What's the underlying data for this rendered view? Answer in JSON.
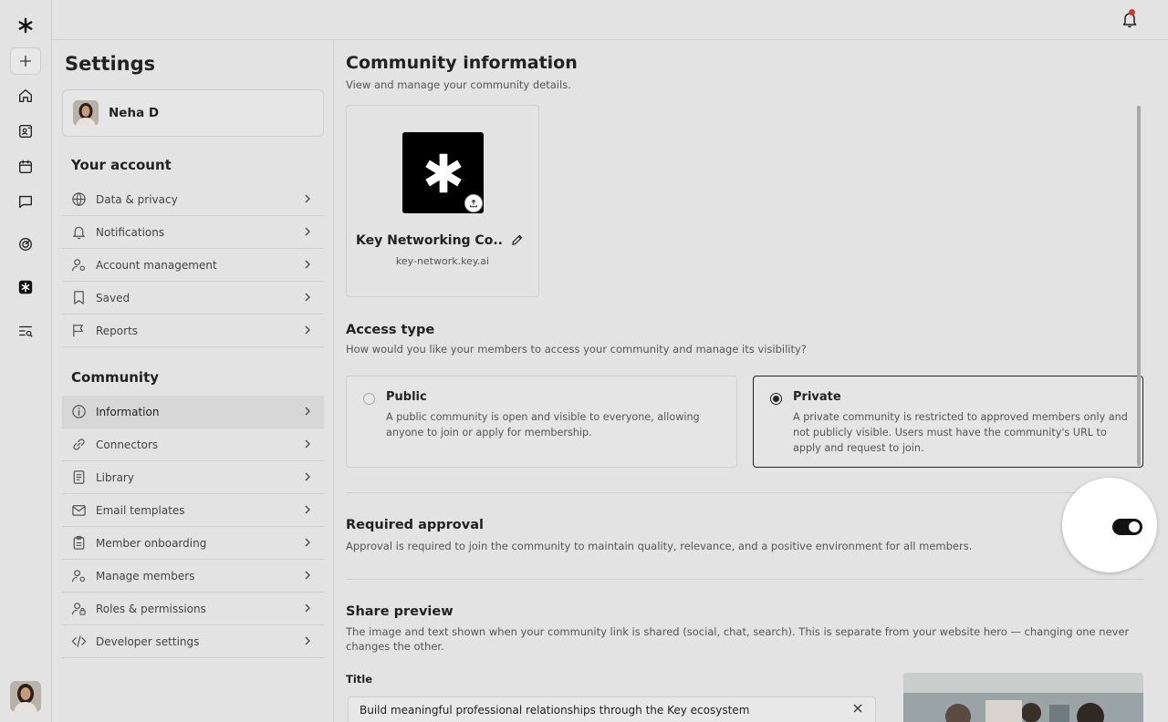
{
  "app": {
    "brand_icon": "key-logo-icon"
  },
  "rail": {
    "items": [
      "add-icon",
      "home-icon",
      "contacts-icon",
      "calendar-icon",
      "chat-icon",
      "analytics-icon",
      "community-icon",
      "search-list-icon"
    ]
  },
  "topbar": {
    "notification_icon": "bell-icon",
    "has_unread": true
  },
  "settings": {
    "title": "Settings",
    "user_name": "Neha D",
    "account_heading": "Your account",
    "account_items": [
      {
        "label": "Data & privacy",
        "icon": "globe-icon"
      },
      {
        "label": "Notifications",
        "icon": "bell-icon"
      },
      {
        "label": "Account management",
        "icon": "user-gear-icon"
      },
      {
        "label": "Saved",
        "icon": "bookmark-icon"
      },
      {
        "label": "Reports",
        "icon": "flag-icon"
      }
    ],
    "community_heading": "Community",
    "community_items": [
      {
        "label": "Information",
        "icon": "info-icon",
        "active": true
      },
      {
        "label": "Connectors",
        "icon": "link-icon"
      },
      {
        "label": "Library",
        "icon": "library-icon"
      },
      {
        "label": "Email templates",
        "icon": "mail-icon"
      },
      {
        "label": "Member onboarding",
        "icon": "clipboard-icon"
      },
      {
        "label": "Manage members",
        "icon": "users-gear-icon"
      },
      {
        "label": "Roles & permissions",
        "icon": "user-lock-icon"
      },
      {
        "label": "Developer settings",
        "icon": "code-icon"
      }
    ]
  },
  "main": {
    "title": "Community information",
    "subtitle": "View and manage your community details.",
    "community": {
      "name": "Key Networking Co...",
      "url": "key-network.key.ai"
    },
    "access": {
      "title": "Access type",
      "subtitle": "How would you like your members to access your community and manage its visibility?",
      "options": [
        {
          "title": "Public",
          "desc": "A public community is open and visible to everyone, allowing anyone to join or apply for membership.",
          "selected": false
        },
        {
          "title": "Private",
          "desc": "A private community is restricted to approved members only and not publicly visible. Users must have the community's URL to apply and request to join.",
          "selected": true
        }
      ]
    },
    "approval": {
      "title": "Required approval",
      "desc": "Approval is required to join the community to maintain quality, relevance, and a positive environment for all members.",
      "enabled": true
    },
    "share": {
      "title": "Share preview",
      "desc": "The image and text shown when your community link is shared (social, chat, search). This is separate from your website hero — changing one never changes the other.",
      "field_label": "Title",
      "field_value": "Build meaningful professional relationships through the Key ecosystem"
    }
  },
  "colors": {
    "background": "#e3e3e3",
    "border": "#cfcfcf",
    "accent": "#111111",
    "notification_dot": "#d0392b"
  }
}
